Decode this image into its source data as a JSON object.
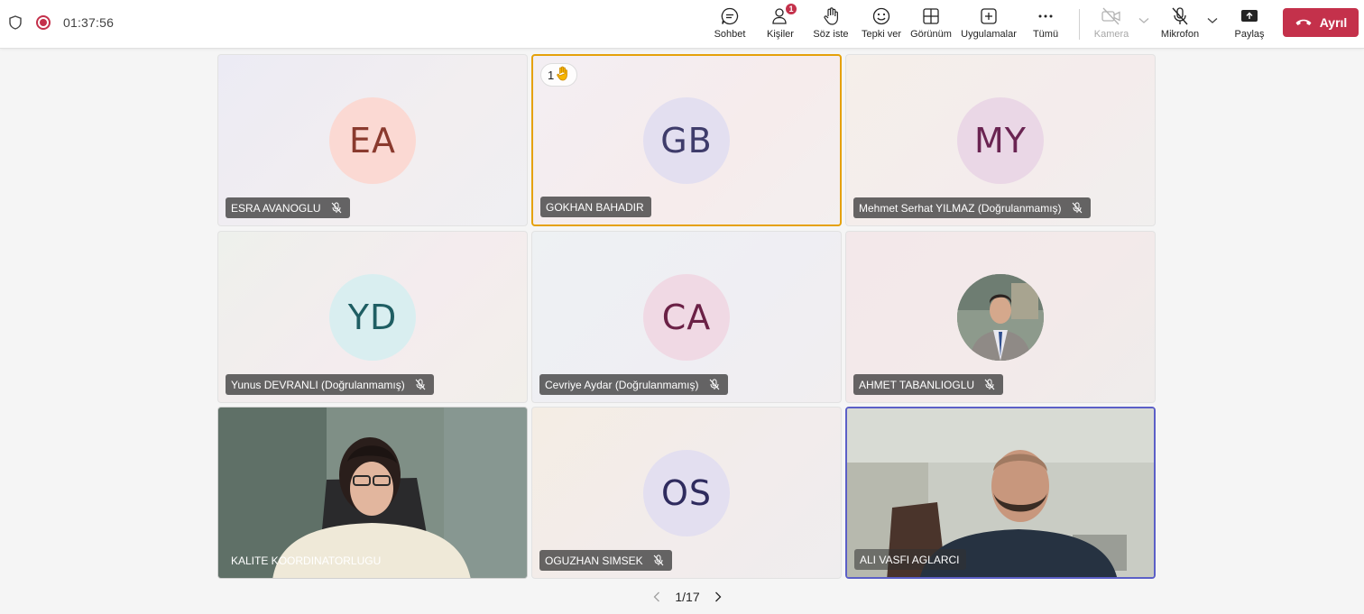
{
  "meeting": {
    "timer": "01:37:56"
  },
  "toolbar": {
    "chat": "Sohbet",
    "people": "Kişiler",
    "people_badge": "1",
    "raise_hand": "Söz iste",
    "react": "Tepki ver",
    "view": "Görünüm",
    "apps": "Uygulamalar",
    "more": "Tümü",
    "camera": "Kamera",
    "mic": "Mikrofon",
    "share": "Paylaş",
    "leave": "Ayrıl"
  },
  "participants": [
    {
      "initials": "EA",
      "name": "ESRA AVANOGLU",
      "muted": true,
      "avatar_bg": "#fbd9d3",
      "avatar_fg": "#8a3a2e",
      "icons": [
        "mic-off-icon"
      ]
    },
    {
      "initials": "GB",
      "name": "GOKHAN BAHADIR",
      "muted": false,
      "hand_count": "1",
      "avatar_bg": "#e3dff0",
      "avatar_fg": "#3f3c6b",
      "icons": [
        "raised-hand-icon"
      ]
    },
    {
      "initials": "MY",
      "name": "Mehmet Serhat YILMAZ (Doğrulanmamış)",
      "muted": true,
      "avatar_bg": "#ead7e6",
      "avatar_fg": "#6a2452",
      "icons": [
        "mic-off-icon"
      ]
    },
    {
      "initials": "YD",
      "name": "Yunus DEVRANLI (Doğrulanmamış)",
      "muted": true,
      "avatar_bg": "#d9eef0",
      "avatar_fg": "#1f5e63",
      "icons": [
        "mic-off-icon"
      ]
    },
    {
      "initials": "CA",
      "name": "Cevriye Aydar (Doğrulanmamış)",
      "muted": true,
      "avatar_bg": "#f0d9e4",
      "avatar_fg": "#6b2146",
      "icons": [
        "mic-off-icon"
      ]
    },
    {
      "name": "AHMET TABANLIOGLU",
      "muted": true,
      "photo": "profile-photo",
      "icons": [
        "mic-off-icon"
      ]
    },
    {
      "name": "KALITE KOORDINATORLUGU",
      "muted": false,
      "video": "camera-feed"
    },
    {
      "initials": "OS",
      "name": "OGUZHAN SIMSEK",
      "muted": true,
      "avatar_bg": "#e3dff0",
      "avatar_fg": "#2f2b5e",
      "icons": [
        "mic-off-icon"
      ]
    },
    {
      "name": "ALI VASFI AGLARCI",
      "muted": false,
      "video": "camera-feed"
    }
  ],
  "pagination": {
    "label": "1/17"
  },
  "colors": {
    "leave": "#c4314b",
    "speaking_border": "#e5a10a",
    "active_border": "#5b5fc7",
    "record": "#c4314b"
  }
}
